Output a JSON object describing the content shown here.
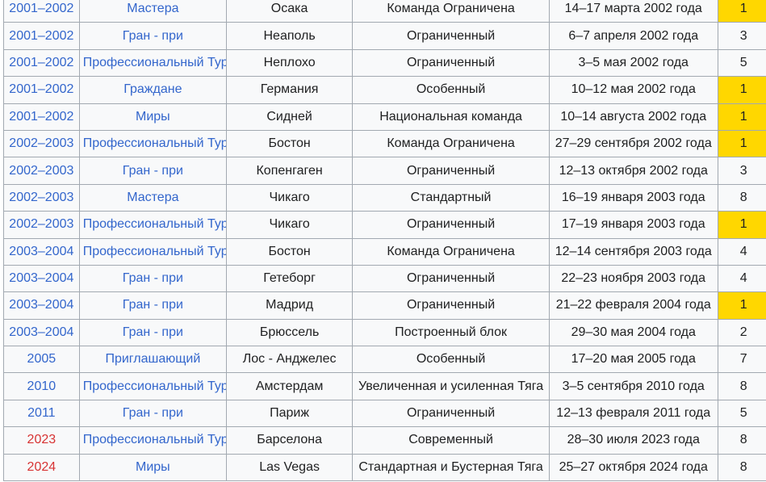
{
  "colors": {
    "link": "#3366cc",
    "missing_link": "#d73333",
    "gold": "#ffd700",
    "cell_bg": "#f8f9fa",
    "border": "#a2a9b1"
  },
  "rows": [
    {
      "season": "2001–2002",
      "event": "Мастера",
      "city": "Осака",
      "format": "Команда Ограничена",
      "date": "14–17 марта 2002 года",
      "place": "1"
    },
    {
      "season": "2001–2002",
      "event": "Гран - при",
      "city": "Неаполь",
      "format": "Ограниченный",
      "date": "6–7 апреля 2002 года",
      "place": "3"
    },
    {
      "season": "2001–2002",
      "event": "Профессиональный Тур",
      "city": "Неплохо",
      "format": "Ограниченный",
      "date": "3–5 мая 2002 года",
      "place": "5"
    },
    {
      "season": "2001–2002",
      "event": "Граждане",
      "city": "Германия",
      "format": "Особенный",
      "date": "10–12 мая 2002 года",
      "place": "1"
    },
    {
      "season": "2001–2002",
      "event": "Миры",
      "city": "Сидней",
      "format": "Национальная команда",
      "date": "10–14 августа 2002 года",
      "place": "1"
    },
    {
      "season": "2002–2003",
      "event": "Профессиональный Тур",
      "city": "Бостон",
      "format": "Команда Ограничена",
      "date": "27–29 сентября 2002 года",
      "place": "1"
    },
    {
      "season": "2002–2003",
      "event": "Гран - при",
      "city": "Копенгаген",
      "format": "Ограниченный",
      "date": "12–13 октября 2002 года",
      "place": "3"
    },
    {
      "season": "2002–2003",
      "event": "Мастера",
      "city": "Чикаго",
      "format": "Стандартный",
      "date": "16–19 января 2003 года",
      "place": "8"
    },
    {
      "season": "2002–2003",
      "event": "Профессиональный Тур",
      "city": "Чикаго",
      "format": "Ограниченный",
      "date": "17–19 января 2003 года",
      "place": "1"
    },
    {
      "season": "2003–2004",
      "event": "Профессиональный Тур",
      "city": "Бостон",
      "format": "Команда Ограничена",
      "date": "12–14 сентября 2003 года",
      "place": "4"
    },
    {
      "season": "2003–2004",
      "event": "Гран - при",
      "city": "Гетеборг",
      "format": "Ограниченный",
      "date": "22–23 ноября 2003 года",
      "place": "4"
    },
    {
      "season": "2003–2004",
      "event": "Гран - при",
      "city": "Мадрид",
      "format": "Ограниченный",
      "date": "21–22 февраля 2004 года",
      "place": "1"
    },
    {
      "season": "2003–2004",
      "event": "Гран - при",
      "city": "Брюссель",
      "format": "Построенный блок",
      "date": "29–30 мая 2004 года",
      "place": "2"
    },
    {
      "season": "2005",
      "event": "Приглашающий",
      "city": "Лос - Анджелес",
      "format": "Особенный",
      "date": "17–20 мая 2005 года",
      "place": "7"
    },
    {
      "season": "2010",
      "event": "Профессиональный Тур",
      "city": "Амстердам",
      "format": "Увеличенная и усиленная Тяга",
      "date": "3–5 сентября 2010 года",
      "place": "8"
    },
    {
      "season": "2011",
      "event": "Гран - при",
      "city": "Париж",
      "format": "Ограниченный",
      "date": "12–13 февраля 2011 года",
      "place": "5"
    },
    {
      "season": "2023",
      "event": "Профессиональный Тур",
      "city": "Барселона",
      "format": "Современный",
      "date": "28–30 июля 2023 года",
      "place": "8",
      "season_missing": true
    },
    {
      "season": "2024",
      "event": "Миры",
      "city": "Las Vegas",
      "format": "Стандартная и Бустерная Тяга",
      "date": "25–27 октября 2024 года",
      "place": "8",
      "season_missing": true
    }
  ]
}
